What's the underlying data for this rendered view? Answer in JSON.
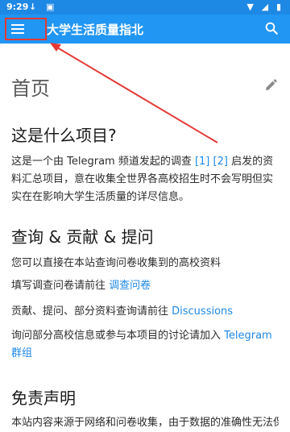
{
  "status_bar": {
    "time": "9:29",
    "left_icons": "↓ ▣",
    "right_icons": "▼ ◢ ▮"
  },
  "app_bar": {
    "title": "大学生活质量指北",
    "menu_icon": "menu-icon",
    "search_icon": "search-icon"
  },
  "page": {
    "title": "首页",
    "edit_icon": "edit-icon"
  },
  "section1": {
    "heading": "这是什么项目?",
    "text_before": "这是一个由 Telegram 频道发起的调查 ",
    "link1": "[1]",
    "space": " ",
    "link2": "[2]",
    "text_after": " 启发的资料汇总项目，意在收集全世界各高校招生时不会写明但实实在在影响大学生活质量的详尽信息。"
  },
  "section2": {
    "heading": "查询 & 贡献 & 提问",
    "line1": "您可以直接在本站查询问卷收集到的高校资料",
    "line2_text": "填写调查问卷请前往 ",
    "line2_link": "调查问卷",
    "line3_text": "贡献、提问、部分资料查询请前往 ",
    "line3_link": "Discussions",
    "line4_text": "询问部分高校信息或参与本项目的讨论请加入 ",
    "line4_link": "Telegram 群组"
  },
  "section3": {
    "heading": "免责声明",
    "text": "本站内容来源于网络和问卷收集，由于数据的准确性无法保"
  },
  "colors": {
    "status_bar": "#1e88e5",
    "app_bar": "#2196f3",
    "link": "#1e88e5",
    "annotation": "#e53935"
  }
}
